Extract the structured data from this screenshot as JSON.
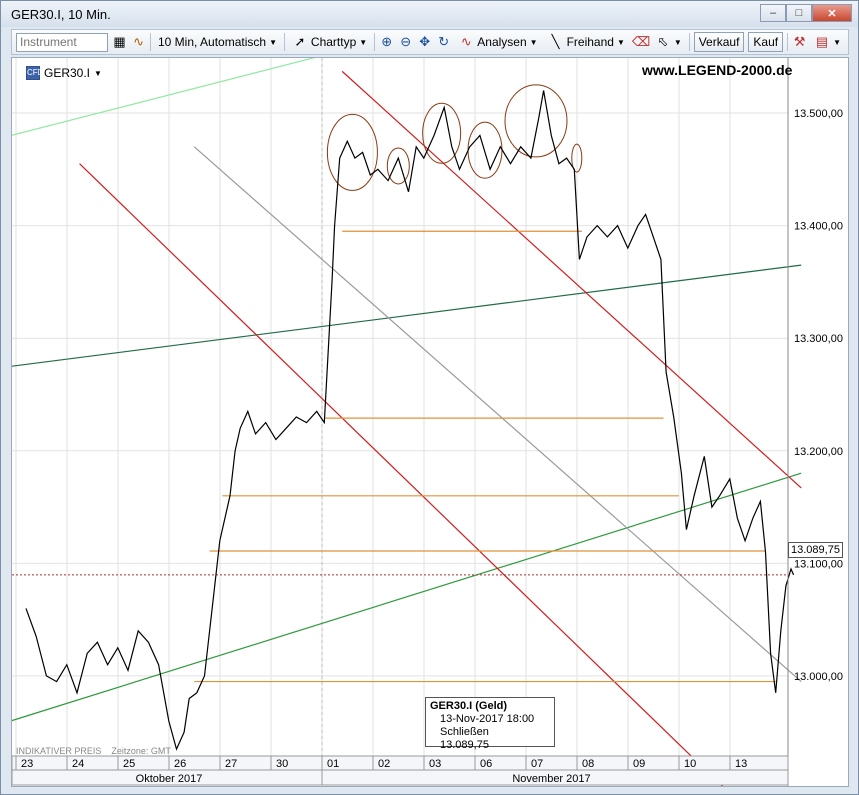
{
  "window": {
    "title": "GER30.I, 10 Min."
  },
  "toolbar": {
    "instrument_placeholder": "Instrument",
    "interval_label": "10 Min,  Automatisch",
    "charttype_label": "Charttyp",
    "analysen_label": "Analysen",
    "freihand_label": "Freihand",
    "verkauf_label": "Verkauf",
    "kauf_label": "Kauf"
  },
  "chart": {
    "symbol": "GER30.I",
    "watermark": "www.LEGEND-2000.de",
    "footer_left": "INDIKATIVER PREIS",
    "footer_timezone": "Zeitzone: GMT",
    "current_price": "13.089,75",
    "infobox": {
      "title": "GER30.I (Geld)",
      "date": "13-Nov-2017 18:00",
      "close_label": "Schließen",
      "close_value": "13.089,75"
    }
  },
  "chart_data": {
    "type": "line",
    "ylim": [
      12920,
      13540
    ],
    "y_ticks": [
      {
        "value": 13000,
        "label": "13.000,00"
      },
      {
        "value": 13100,
        "label": "13.100,00"
      },
      {
        "value": 13200,
        "label": "13.200,00"
      },
      {
        "value": 13300,
        "label": "13.300,00"
      },
      {
        "value": 13400,
        "label": "13.400,00"
      },
      {
        "value": 13500,
        "label": "13.500,00"
      }
    ],
    "x_days": [
      "23",
      "24",
      "25",
      "26",
      "27",
      "30",
      "01",
      "02",
      "03",
      "06",
      "07",
      "08",
      "09",
      "10",
      "13"
    ],
    "months": [
      {
        "label": "Oktober 2017",
        "from": 0,
        "to": 5
      },
      {
        "label": "November 2017",
        "from": 6,
        "to": 14
      }
    ],
    "series": [
      {
        "values": [
          [
            0.0,
            13060
          ],
          [
            0.2,
            13035
          ],
          [
            0.4,
            13000
          ],
          [
            0.6,
            12995
          ],
          [
            0.8,
            13010
          ],
          [
            1.0,
            12985
          ],
          [
            1.2,
            13020
          ],
          [
            1.4,
            13030
          ],
          [
            1.6,
            13010
          ],
          [
            1.8,
            13025
          ],
          [
            2.0,
            13005
          ],
          [
            2.2,
            13040
          ],
          [
            2.4,
            13030
          ],
          [
            2.6,
            13010
          ],
          [
            2.8,
            12960
          ],
          [
            2.95,
            12935
          ],
          [
            3.1,
            12950
          ],
          [
            3.2,
            12980
          ],
          [
            3.35,
            12985
          ],
          [
            3.5,
            13000
          ],
          [
            3.6,
            13040
          ],
          [
            3.7,
            13080
          ],
          [
            3.8,
            13120
          ],
          [
            3.9,
            13140
          ],
          [
            4.0,
            13160
          ],
          [
            4.1,
            13200
          ],
          [
            4.2,
            13220
          ],
          [
            4.35,
            13235
          ],
          [
            4.5,
            13215
          ],
          [
            4.7,
            13225
          ],
          [
            4.9,
            13210
          ],
          [
            5.1,
            13220
          ],
          [
            5.3,
            13230
          ],
          [
            5.5,
            13225
          ],
          [
            5.7,
            13235
          ],
          [
            5.85,
            13225
          ],
          [
            6.0,
            13350
          ],
          [
            6.05,
            13400
          ],
          [
            6.15,
            13460
          ],
          [
            6.3,
            13475
          ],
          [
            6.45,
            13460
          ],
          [
            6.6,
            13465
          ],
          [
            6.75,
            13445
          ],
          [
            6.9,
            13450
          ],
          [
            7.1,
            13440
          ],
          [
            7.3,
            13460
          ],
          [
            7.5,
            13430
          ],
          [
            7.65,
            13470
          ],
          [
            7.8,
            13460
          ],
          [
            8.0,
            13480
          ],
          [
            8.2,
            13505
          ],
          [
            8.35,
            13470
          ],
          [
            8.5,
            13450
          ],
          [
            8.7,
            13470
          ],
          [
            8.9,
            13480
          ],
          [
            9.1,
            13450
          ],
          [
            9.3,
            13470
          ],
          [
            9.5,
            13455
          ],
          [
            9.7,
            13470
          ],
          [
            9.9,
            13460
          ],
          [
            10.05,
            13495
          ],
          [
            10.15,
            13520
          ],
          [
            10.3,
            13480
          ],
          [
            10.45,
            13455
          ],
          [
            10.6,
            13460
          ],
          [
            10.75,
            13450
          ],
          [
            10.85,
            13370
          ],
          [
            11.0,
            13390
          ],
          [
            11.2,
            13400
          ],
          [
            11.4,
            13390
          ],
          [
            11.6,
            13400
          ],
          [
            11.8,
            13380
          ],
          [
            12.0,
            13400
          ],
          [
            12.15,
            13410
          ],
          [
            12.3,
            13390
          ],
          [
            12.45,
            13370
          ],
          [
            12.55,
            13270
          ],
          [
            12.7,
            13230
          ],
          [
            12.85,
            13180
          ],
          [
            12.95,
            13130
          ],
          [
            13.1,
            13160
          ],
          [
            13.3,
            13195
          ],
          [
            13.45,
            13150
          ],
          [
            13.6,
            13160
          ],
          [
            13.8,
            13175
          ],
          [
            13.95,
            13140
          ],
          [
            14.1,
            13120
          ],
          [
            14.25,
            13140
          ],
          [
            14.4,
            13155
          ],
          [
            14.5,
            13110
          ],
          [
            14.6,
            13020
          ],
          [
            14.7,
            12985
          ],
          [
            14.8,
            13040
          ],
          [
            14.9,
            13080
          ],
          [
            15.0,
            13095
          ],
          [
            15.05,
            13089.75
          ]
        ]
      }
    ],
    "horizontal_levels": [
      13395,
      13229,
      13160,
      13111,
      12995
    ],
    "current_level": 13089.75
  }
}
